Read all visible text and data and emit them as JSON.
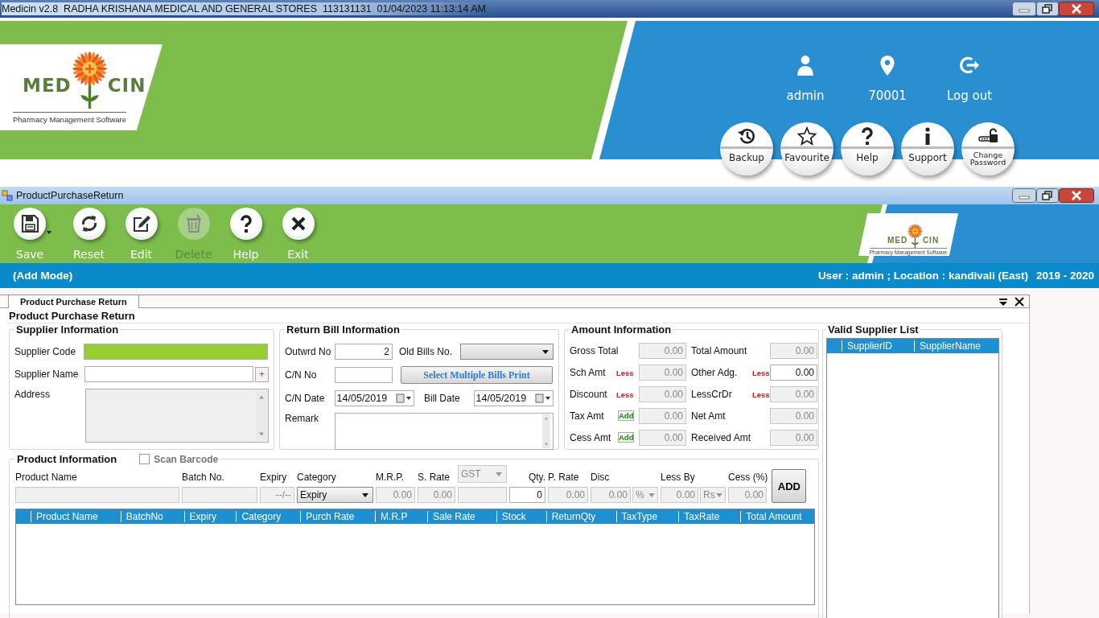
{
  "title_bar": {
    "text": "Medicin v2.8  RADHA KRISHANA MEDICAL AND GENERAL STORES  113131131  01/04/2023 11:13:14 AM"
  },
  "logo": {
    "left": "MED",
    "right": "CIN",
    "tagline": "Pharmacy Management Software"
  },
  "user_links": [
    {
      "kind": "user",
      "label": "admin"
    },
    {
      "kind": "location",
      "label": "70001"
    },
    {
      "kind": "logout",
      "label": "Log out"
    }
  ],
  "quick_buttons": [
    {
      "kind": "backup",
      "label": "Backup"
    },
    {
      "kind": "favourite",
      "label": "Favourite"
    },
    {
      "kind": "help",
      "label": "Help"
    },
    {
      "kind": "support",
      "label": "Support"
    },
    {
      "kind": "password",
      "label": "Change Password"
    }
  ],
  "child_window": {
    "title": "ProductPurchaseReturn"
  },
  "small_logo": {
    "left": "MED",
    "right": "CIN",
    "tagline": "Pharmacy Management Software"
  },
  "toolbar": [
    {
      "kind": "save",
      "label": "Save",
      "disabled": false,
      "dropdown": true
    },
    {
      "kind": "reset",
      "label": "Reset",
      "disabled": false,
      "dropdown": false
    },
    {
      "kind": "edit",
      "label": "Edit",
      "disabled": false,
      "dropdown": false
    },
    {
      "kind": "delete",
      "label": "Delete",
      "disabled": true,
      "dropdown": false
    },
    {
      "kind": "help",
      "label": "Help",
      "disabled": false,
      "dropdown": false
    },
    {
      "kind": "exit",
      "label": "Exit",
      "disabled": false,
      "dropdown": false
    }
  ],
  "mode_bar": {
    "mode": "(Add Mode)",
    "info": "User : admin ; Location : kandivali (East)",
    "year": "2019 - 2020"
  },
  "tabs": [
    {
      "label": "Product Purchase Return",
      "selected": true
    }
  ],
  "form_title": "Product Purchase Return",
  "supplier_info": {
    "title": "Supplier Information",
    "code_label": "Supplier Code",
    "code_highlighted": true,
    "name_label": "Supplier Name",
    "add_button": "+",
    "address_label": "Address"
  },
  "return_bill": {
    "title": "Return Bill  Information",
    "outward_label": "Outwrd No",
    "outward_value": "2",
    "old_bills_label": "Old Bills No.",
    "cn_no_label": "C/N No",
    "print_button": "Select Multiple Bills Print",
    "cn_date_label": "C/N Date",
    "cn_date": "14/05/2019",
    "bill_date_label": "Bill Date",
    "bill_date": "14/05/2019",
    "remark_label": "Remark"
  },
  "amount_info": {
    "title": "Amount Information",
    "left": [
      {
        "label": "Gross Total",
        "value": "0.00",
        "disabled": true
      },
      {
        "label": "Sch Amt",
        "tag": {
          "text": "Less",
          "kind": "less"
        },
        "value": "0.00",
        "disabled": true
      },
      {
        "label": "Discount",
        "tag": {
          "text": "Less",
          "kind": "less"
        },
        "value": "0.00",
        "disabled": true
      },
      {
        "label": "Tax Amt",
        "tag": {
          "text": "Add",
          "kind": "add"
        },
        "value": "0.00",
        "disabled": true
      },
      {
        "label": "Cess Amt",
        "tag": {
          "text": "Add",
          "kind": "add"
        },
        "value": "0.00",
        "disabled": true
      }
    ],
    "right": [
      {
        "label": "Total Amount",
        "value": "0.00",
        "disabled": true
      },
      {
        "label": "Other Adg.",
        "tag": {
          "text": "Less",
          "kind": "less"
        },
        "value": "0.00",
        "disabled": false
      },
      {
        "label": "LessCrDr",
        "tag": {
          "text": "Less",
          "kind": "less"
        },
        "value": "0.00",
        "disabled": true
      },
      {
        "label": "Net Amt",
        "value": "0.00",
        "disabled": true
      },
      {
        "label": "Received Amt",
        "value": "0.00",
        "disabled": true
      }
    ]
  },
  "product_info": {
    "title": "Product Information",
    "scan_barcode": {
      "label": "Scan Barcode",
      "checked": false
    },
    "fields": [
      {
        "label": "Product Name",
        "kind": "text",
        "disabled": true
      },
      {
        "label": "Batch No.",
        "kind": "text",
        "disabled": true
      },
      {
        "label": "Expiry",
        "kind": "text",
        "value": "--/--",
        "disabled": true
      },
      {
        "label": "Category",
        "kind": "select",
        "value": "Expiry",
        "disabled": false
      },
      {
        "label": "M.R.P.",
        "kind": "text",
        "value": "0.00",
        "disabled": true
      },
      {
        "label": "S. Rate",
        "kind": "text",
        "value": "0.00",
        "disabled": true
      },
      {
        "header_select": "GST",
        "kind": "text",
        "disabled": true
      },
      {
        "label": "Qty.",
        "kind": "text",
        "value": "0",
        "disabled": false
      },
      {
        "label": "P. Rate",
        "kind": "text",
        "value": "0.00",
        "disabled": true
      },
      {
        "label": "Disc",
        "kind": "text",
        "value": "0.00",
        "disabled": true,
        "unit": "%"
      },
      {
        "label": "Less By",
        "kind": "text",
        "value": "0.00",
        "disabled": true,
        "unit": "Rs"
      },
      {
        "label": "Cess (%)",
        "kind": "text",
        "value": "0.00",
        "disabled": true
      }
    ],
    "add_button": "ADD",
    "table": {
      "columns": [
        "Product Name",
        "BatchNo",
        "Expiry",
        "Category",
        "Purch Rate",
        "M.R.P",
        "Sale Rate",
        "Stock",
        "ReturnQty",
        "TaxType",
        "TaxRate",
        "Total Amount"
      ]
    }
  },
  "supplier_list": {
    "title": "Valid Supplier List",
    "columns": [
      "SupplierID",
      "SupplierName"
    ]
  }
}
